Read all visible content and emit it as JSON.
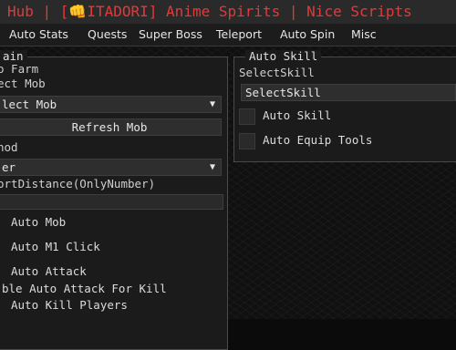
{
  "window": {
    "title": "Hub | [👊ITADORI] Anime Spirits | Nice Scripts"
  },
  "tabs": [
    {
      "label": "Auto Stats"
    },
    {
      "label": "Quests"
    },
    {
      "label": "Super Boss"
    },
    {
      "label": "Teleport"
    },
    {
      "label": "Auto Spin"
    },
    {
      "label": "Misc"
    }
  ],
  "main_panel": {
    "title": "ain",
    "auto_farm_label": "o Farm",
    "select_mob_label": "ect Mob",
    "mob_dropdown": {
      "value": "lect Mob",
      "arrow": "▼"
    },
    "refresh_mob_button": "Refresh Mob",
    "method_label": "hod",
    "method_dropdown": {
      "value": "er",
      "arrow": "▼"
    },
    "distance_label": "ortDistance(OnlyNumber)",
    "distance_input": "",
    "checks": [
      {
        "label": "Auto Mob",
        "checked": false
      },
      {
        "label": "Auto M1 Click",
        "checked": false
      },
      {
        "label": "Auto Attack",
        "checked": false
      },
      {
        "label": "ble Auto Attack For Kill",
        "checked": false
      },
      {
        "label": "Auto Kill Players",
        "checked": false
      }
    ]
  },
  "skill_panel": {
    "title": "Auto Skill",
    "select_skill_label": "SelectSkill",
    "skill_dropdown": {
      "value": "SelectSkill"
    },
    "checks": [
      {
        "label": "Auto Skill",
        "checked": false
      },
      {
        "label": "Auto Equip Tools",
        "checked": false
      }
    ]
  },
  "colors": {
    "title_text": "#e23a3a",
    "title_bar_bg": "#2a2a2a",
    "panel_bg": "#1b1b1b",
    "control_bg": "#2e2e2e"
  }
}
